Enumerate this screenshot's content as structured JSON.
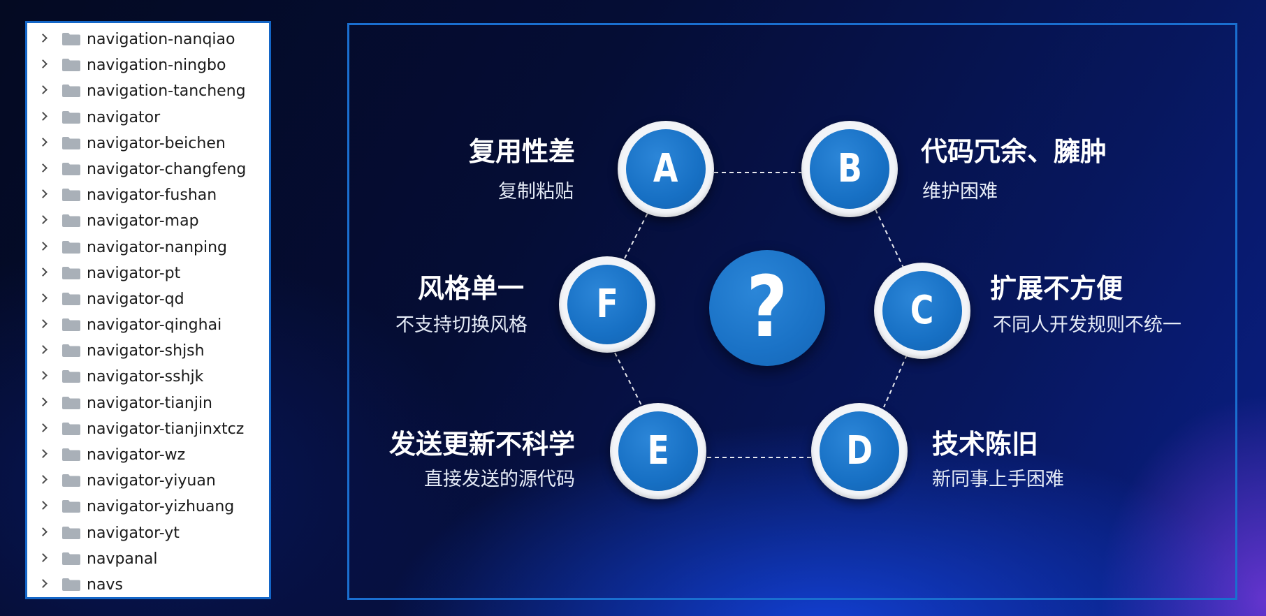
{
  "tree": {
    "items": [
      "navigation-nanqiao",
      "navigation-ningbo",
      "navigation-tancheng",
      "navigator",
      "navigator-beichen",
      "navigator-changfeng",
      "navigator-fushan",
      "navigator-map",
      "navigator-nanping",
      "navigator-pt",
      "navigator-qd",
      "navigator-qinghai",
      "navigator-shjsh",
      "navigator-sshjk",
      "navigator-tianjin",
      "navigator-tianjinxtcz",
      "navigator-wz",
      "navigator-yiyuan",
      "navigator-yizhuang",
      "navigator-yt",
      "navpanal",
      "navs"
    ],
    "chevron_icon": "chevron-right-icon",
    "folder_icon": "folder-icon",
    "folder_color": "#a9b0b8"
  },
  "diagram": {
    "center_symbol": "?",
    "accent_color": "#1770c4",
    "nodes": {
      "a": {
        "letter": "A",
        "title": "复用性差",
        "subtitle": "复制粘贴"
      },
      "b": {
        "letter": "B",
        "title": "代码冗余、臃肿",
        "subtitle": "维护困难"
      },
      "c": {
        "letter": "C",
        "title": "扩展不方便",
        "subtitle": "不同人开发规则不统一"
      },
      "d": {
        "letter": "D",
        "title": "技术陈旧",
        "subtitle": "新同事上手困难"
      },
      "e": {
        "letter": "E",
        "title": "发送更新不科学",
        "subtitle": "直接发送的源代码"
      },
      "f": {
        "letter": "F",
        "title": "风格单一",
        "subtitle": "不支持切换风格"
      }
    }
  }
}
